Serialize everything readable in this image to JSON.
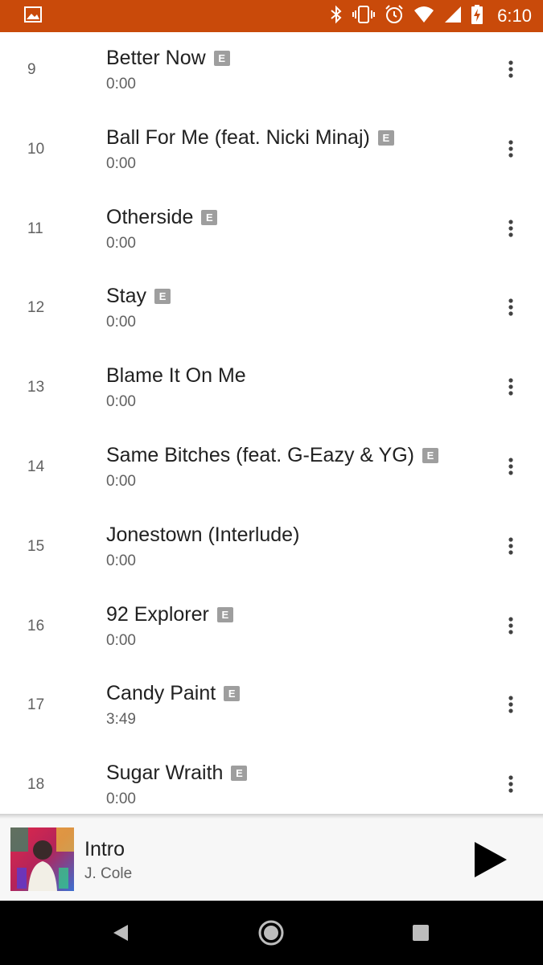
{
  "status_bar": {
    "time": "6:10",
    "background": "#c94a0a",
    "icons": [
      "image-icon",
      "bluetooth-icon",
      "vibrate-icon",
      "alarm-icon",
      "wifi-icon",
      "signal-icon",
      "battery-charging-icon"
    ]
  },
  "tracks": [
    {
      "number": "9",
      "title": "Better Now",
      "duration": "0:00",
      "explicit": "E"
    },
    {
      "number": "10",
      "title": "Ball For Me (feat. Nicki Minaj)",
      "duration": "0:00",
      "explicit": "E"
    },
    {
      "number": "11",
      "title": "Otherside",
      "duration": "0:00",
      "explicit": "E"
    },
    {
      "number": "12",
      "title": "Stay",
      "duration": "0:00",
      "explicit": "E"
    },
    {
      "number": "13",
      "title": "Blame It On Me",
      "duration": "0:00",
      "explicit": ""
    },
    {
      "number": "14",
      "title": "Same Bitches (feat. G-Eazy & YG)",
      "duration": "0:00",
      "explicit": "E"
    },
    {
      "number": "15",
      "title": "Jonestown (Interlude)",
      "duration": "0:00",
      "explicit": ""
    },
    {
      "number": "16",
      "title": "92 Explorer",
      "duration": "0:00",
      "explicit": "E"
    },
    {
      "number": "17",
      "title": "Candy Paint",
      "duration": "3:49",
      "explicit": "E"
    },
    {
      "number": "18",
      "title": "Sugar Wraith",
      "duration": "0:00",
      "explicit": "E"
    }
  ],
  "now_playing": {
    "title": "Intro",
    "artist": "J. Cole",
    "play_icon": "play-icon"
  },
  "nav_bar": {
    "icons": [
      "back-icon",
      "home-icon",
      "recents-icon"
    ]
  }
}
